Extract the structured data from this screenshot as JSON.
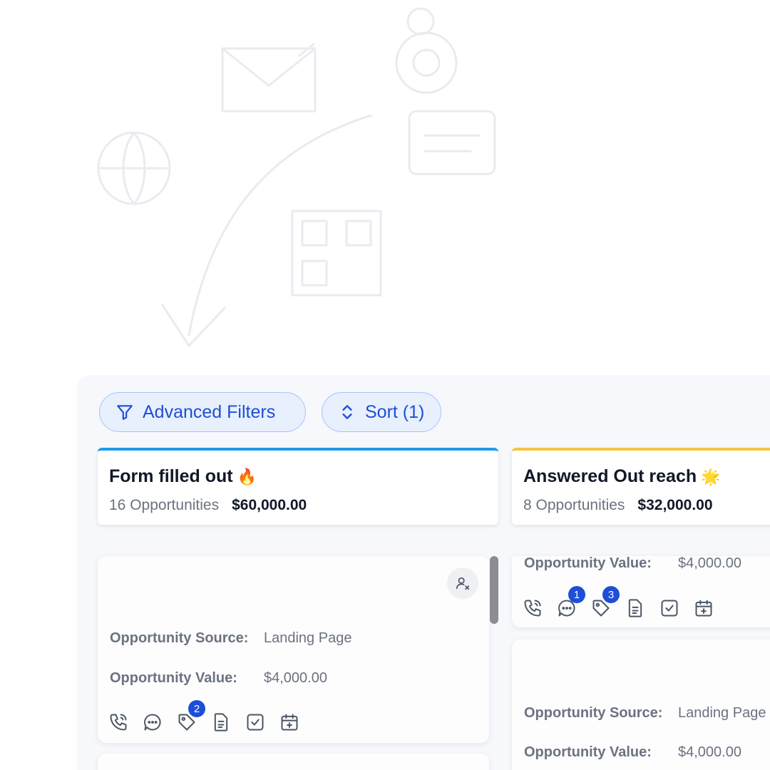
{
  "toolbar": {
    "filters_label": "Advanced Filters",
    "sort_label": "Sort (1)"
  },
  "stages": [
    {
      "title": "Form filled out",
      "emoji": "🔥",
      "count": "16 Opportunities",
      "value": "$60,000.00",
      "color": "#1e9be9"
    },
    {
      "title": "Answered Out reach",
      "emoji": "🌟",
      "count": "8 Opportunities",
      "value": "$32,000.00",
      "color": "#f5c542"
    }
  ],
  "cards": [
    {
      "source_label": "Opportunity Source:",
      "source_value": "Landing Page",
      "value_label": "Opportunity Value:",
      "value_value": "$4,000.00",
      "badges": {
        "tags": "2"
      }
    },
    {
      "value_label": "Opportunity Value:",
      "value_value": "$4,000.00",
      "badges": {
        "messages": "1",
        "tags": "3"
      }
    },
    {
      "source_label": "Opportunity Source:",
      "source_value": "Landing Page",
      "value_label": "Opportunity Value:",
      "value_value": "$4,000.00"
    }
  ],
  "colors": {
    "accent": "#1d4ed8",
    "pill_bg": "#e8effd",
    "icon": "#4b5563"
  }
}
